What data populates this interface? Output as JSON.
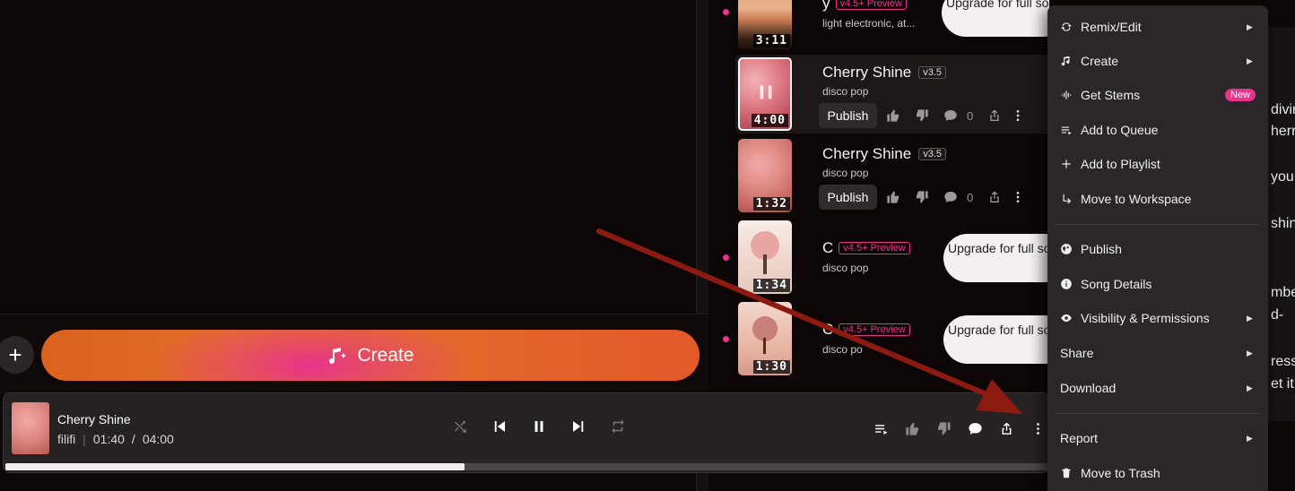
{
  "create": {
    "plus": "+",
    "label": "Create"
  },
  "songs": [
    {
      "title": "y",
      "genre": "light electronic, at...",
      "preview": "v4.5+ Preview",
      "duration": "3:11",
      "upgrade": "Upgrade for full song"
    },
    {
      "title": "Cherry Shine",
      "genre": "disco pop",
      "version": "v3.5",
      "duration": "4:00",
      "publish": "Publish",
      "comments": "0"
    },
    {
      "title": "Cherry Shine",
      "genre": "disco pop",
      "version": "v3.5",
      "duration": "1:32",
      "publish": "Publish",
      "comments": "0"
    },
    {
      "title": "C",
      "genre": "disco pop",
      "preview": "v4.5+ Preview",
      "duration": "1:34",
      "upgrade": "Upgrade for full song"
    },
    {
      "title": "C",
      "genre": "disco po",
      "preview": "v4.5+ Preview",
      "duration": "1:30",
      "upgrade": "Upgrade for full song"
    }
  ],
  "player": {
    "title": "Cherry Shine",
    "artist": "filifi",
    "separator": "|",
    "elapsed": "01:40",
    "time_sep": "/",
    "total": "04:00",
    "progress": 0.44
  },
  "menu": {
    "items": [
      {
        "label": "Remix/Edit",
        "icon": "remix-icon",
        "submenu": true
      },
      {
        "label": "Create",
        "icon": "music-note-icon",
        "submenu": true
      },
      {
        "label": "Get Stems",
        "icon": "stems-icon",
        "badge": "New"
      },
      {
        "label": "Add to Queue",
        "icon": "queue-icon"
      },
      {
        "label": "Add to Playlist",
        "icon": "plus-icon"
      },
      {
        "label": "Move to Workspace",
        "icon": "move-arrow-icon"
      },
      {
        "label": "Publish",
        "icon": "globe-icon"
      },
      {
        "label": "Song Details",
        "icon": "info-icon"
      },
      {
        "label": "Visibility & Permissions",
        "icon": "eye-icon",
        "submenu": true
      },
      {
        "label": "Share",
        "submenu": true
      },
      {
        "label": "Download",
        "submenu": true
      },
      {
        "label": "Report",
        "submenu": true
      },
      {
        "label": "Move to Trash",
        "icon": "trash-icon"
      }
    ]
  },
  "right_fragments": [
    "divin",
    "herry",
    "you",
    "shin",
    "mbe",
    "d-",
    "ress",
    "et it"
  ],
  "colors": {
    "accent": "#e8338b",
    "create_orange": "#e4702a",
    "arrow": "#8b1a10"
  }
}
